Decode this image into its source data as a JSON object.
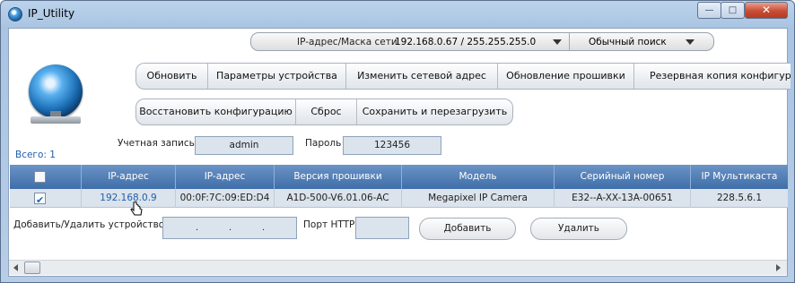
{
  "window": {
    "title": "IP_Utility",
    "minimize_symbol": "—",
    "maximize_symbol": "□",
    "close_symbol": "✕"
  },
  "filter": {
    "label": "IP-адрес/Маска сети",
    "value": "192.168.0.67 / 255.255.255.0",
    "search_mode": "Обычный поиск"
  },
  "toolbar1": [
    "Обновить",
    "Параметры устройства",
    "Изменить сетевой адрес",
    "Обновление прошивки",
    "Резервная копия конфигурации"
  ],
  "toolbar2": [
    "Восстановить конфигурацию",
    "Сброс",
    "Сохранить и перезагрузить"
  ],
  "total": "Всего: 1",
  "account": {
    "label": "Учетная запись",
    "value": "admin"
  },
  "password": {
    "label": "Пароль",
    "value": "123456"
  },
  "table": {
    "headers": [
      "IP-адрес",
      "IP-адрес",
      "Версия прошивки",
      "Модель",
      "Серийный номер",
      "IP Мультикаста"
    ],
    "rows": [
      {
        "checked": true,
        "cells": [
          "192.168.0.9",
          "00:0F:7C:09:ED:D4",
          "A1D-500-V6.01.06-AC",
          "Megapixel IP Camera",
          "E32--A-XX-13A-00651",
          "228.5.6.1"
        ]
      }
    ]
  },
  "add_remove": {
    "label": "Добавить/Удалить устройство",
    "port_label": "Порт HTTP",
    "add_label": "Добавить",
    "delete_label": "Удалить"
  },
  "colors": {
    "header_blue": "#3f6ea8",
    "row_fill": "#dbe3ec",
    "link_blue": "#1f5fa8"
  }
}
